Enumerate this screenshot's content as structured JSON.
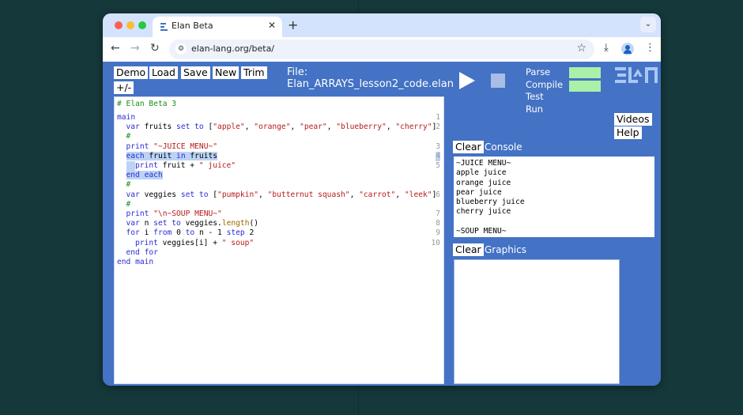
{
  "browser": {
    "tab_title": "Elan Beta",
    "tab_close": "✕",
    "new_tab": "+",
    "tabs_dropdown": "⌄",
    "url": "elan-lang.org/beta/",
    "icons": {
      "back": "←",
      "forward": "→",
      "reload": "↻",
      "site_info": "⚙",
      "bookmark": "☆",
      "download": "⤓",
      "menu": "⋮"
    }
  },
  "toolbar": {
    "demo": "Demo",
    "load": "Load",
    "save": "Save",
    "new": "New",
    "trim": "Trim",
    "expand_collapse": "+/-",
    "file_label": "File:",
    "file_name": "Elan_ARRAYS_lesson2_code.elan"
  },
  "status": {
    "parse": "Parse",
    "compile": "Compile",
    "test": "Test",
    "run": "Run",
    "parse_color": "#aaf0a8",
    "compile_color": "#aaf0a8"
  },
  "links": {
    "videos": "Videos",
    "help": "Help"
  },
  "editor": {
    "header_comment": "# Elan Beta 3",
    "lines": [
      {
        "indent": 0,
        "ln": "1",
        "tokens": [
          {
            "t": "main",
            "c": "kw"
          }
        ]
      },
      {
        "indent": 1,
        "ln": "2",
        "tokens": [
          {
            "t": "var ",
            "c": "kw"
          },
          {
            "t": "fruits ",
            "c": "id"
          },
          {
            "t": "set to ",
            "c": "kw"
          },
          {
            "t": "[",
            "c": "id"
          },
          {
            "t": "\"apple\"",
            "c": "str"
          },
          {
            "t": ", ",
            "c": "id"
          },
          {
            "t": "\"orange\"",
            "c": "str"
          },
          {
            "t": ", ",
            "c": "id"
          },
          {
            "t": "\"pear\"",
            "c": "str"
          },
          {
            "t": ", ",
            "c": "id"
          },
          {
            "t": "\"blueberry\"",
            "c": "str"
          },
          {
            "t": ", ",
            "c": "id"
          },
          {
            "t": "\"cherry\"",
            "c": "str"
          },
          {
            "t": "]",
            "c": "id"
          }
        ]
      },
      {
        "indent": 1,
        "ln": "",
        "tokens": [
          {
            "t": "#",
            "c": "comment"
          }
        ]
      },
      {
        "indent": 1,
        "ln": "3",
        "tokens": [
          {
            "t": "print ",
            "c": "kw"
          },
          {
            "t": "\"~JUICE MENU~\"",
            "c": "str"
          }
        ]
      },
      {
        "indent": 1,
        "ln": "4",
        "selected": true,
        "tokens": [
          {
            "t": "each ",
            "c": "kw"
          },
          {
            "t": "fruit ",
            "c": "id"
          },
          {
            "t": "in ",
            "c": "kw"
          },
          {
            "t": "fruits",
            "c": "id"
          }
        ]
      },
      {
        "indent": 2,
        "ln": "5",
        "selected_indent": true,
        "tokens": [
          {
            "t": "print ",
            "c": "kw"
          },
          {
            "t": "fruit + ",
            "c": "id"
          },
          {
            "t": "\" juice\"",
            "c": "str"
          }
        ]
      },
      {
        "indent": 1,
        "ln": "",
        "selected": true,
        "tokens": [
          {
            "t": "end each",
            "c": "kw"
          }
        ]
      },
      {
        "indent": 1,
        "ln": "",
        "tokens": [
          {
            "t": "#",
            "c": "comment"
          }
        ]
      },
      {
        "indent": 1,
        "ln": "6",
        "tokens": [
          {
            "t": "var ",
            "c": "kw"
          },
          {
            "t": "veggies ",
            "c": "id"
          },
          {
            "t": "set to ",
            "c": "kw"
          },
          {
            "t": "[",
            "c": "id"
          },
          {
            "t": "\"pumpkin\"",
            "c": "str"
          },
          {
            "t": ", ",
            "c": "id"
          },
          {
            "t": "\"butternut squash\"",
            "c": "str"
          },
          {
            "t": ", ",
            "c": "id"
          },
          {
            "t": "\"carrot\"",
            "c": "str"
          },
          {
            "t": ", ",
            "c": "id"
          },
          {
            "t": "\"leek\"",
            "c": "str"
          },
          {
            "t": "]",
            "c": "id"
          }
        ]
      },
      {
        "indent": 1,
        "ln": "",
        "tokens": [
          {
            "t": "#",
            "c": "comment"
          }
        ]
      },
      {
        "indent": 1,
        "ln": "7",
        "tokens": [
          {
            "t": "print ",
            "c": "kw"
          },
          {
            "t": "\"\\n~SOUP MENU~\"",
            "c": "str"
          }
        ]
      },
      {
        "indent": 1,
        "ln": "8",
        "tokens": [
          {
            "t": "var ",
            "c": "kw"
          },
          {
            "t": "n ",
            "c": "id"
          },
          {
            "t": "set to ",
            "c": "kw"
          },
          {
            "t": "veggies.",
            "c": "id"
          },
          {
            "t": "length",
            "c": "meth"
          },
          {
            "t": "()",
            "c": "id"
          }
        ]
      },
      {
        "indent": 1,
        "ln": "9",
        "tokens": [
          {
            "t": "for ",
            "c": "kw"
          },
          {
            "t": "i ",
            "c": "id"
          },
          {
            "t": "from ",
            "c": "kw"
          },
          {
            "t": "0 ",
            "c": "id"
          },
          {
            "t": "to ",
            "c": "kw"
          },
          {
            "t": "n - 1 ",
            "c": "id"
          },
          {
            "t": "step ",
            "c": "kw"
          },
          {
            "t": "2",
            "c": "id"
          }
        ]
      },
      {
        "indent": 2,
        "ln": "10",
        "tokens": [
          {
            "t": "print ",
            "c": "kw"
          },
          {
            "t": "veggies[i] + ",
            "c": "id"
          },
          {
            "t": "\" soup\"",
            "c": "str"
          }
        ]
      },
      {
        "indent": 1,
        "ln": "",
        "tokens": [
          {
            "t": "end for",
            "c": "kw"
          }
        ]
      },
      {
        "indent": 0,
        "ln": "",
        "tokens": [
          {
            "t": "end main",
            "c": "kw"
          }
        ]
      }
    ]
  },
  "console": {
    "clear": "Clear",
    "label": "Console",
    "output": "~JUICE MENU~\napple juice\norange juice\npear juice\nblueberry juice\ncherry juice\n\n~SOUP MENU~"
  },
  "graphics": {
    "clear": "Clear",
    "label": "Graphics"
  }
}
